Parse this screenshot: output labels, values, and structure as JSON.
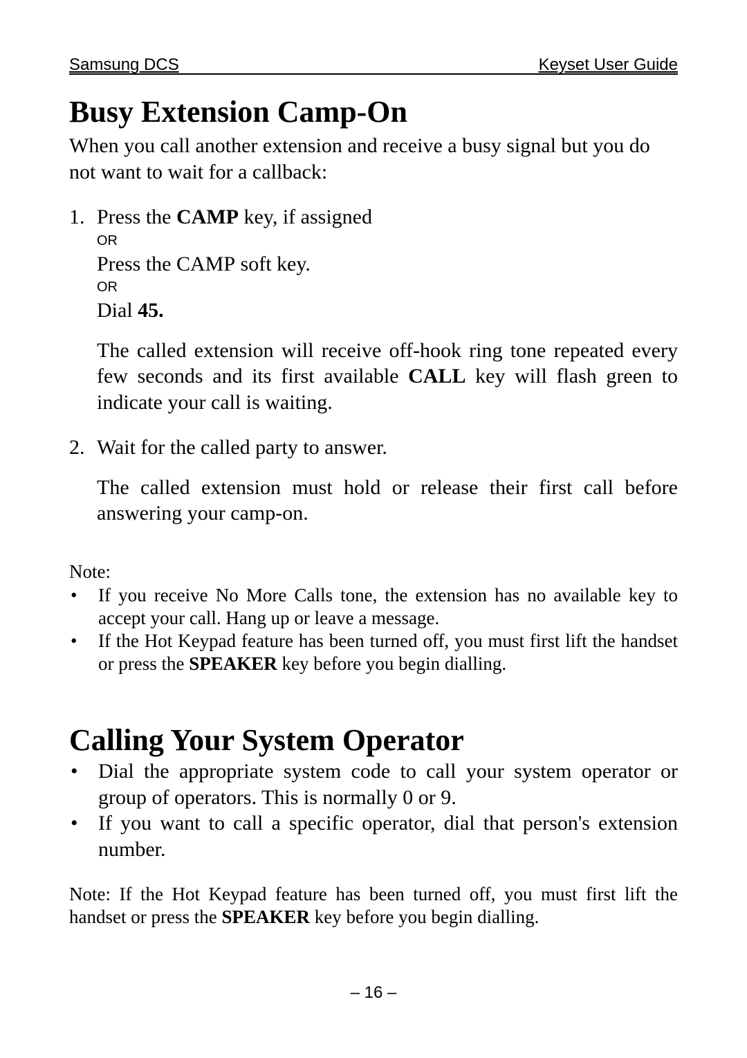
{
  "header": {
    "left": "Samsung DCS",
    "right": "Keyset User Guide"
  },
  "sec1": {
    "title": "Busy Extension Camp-On",
    "intro": "When you call another extension and receive a busy signal but you do not want to wait for a callback:",
    "step1_num": "1.",
    "step1_l1_pre": "Press the ",
    "step1_l1_key": "CAMP",
    "step1_l1_post": " key, if assigned",
    "or": "OR",
    "step1_l2_pre": "Press the ",
    "step1_l2_key": "CAMP",
    "step1_l2_post": " soft key.",
    "step1_l3_pre": "Dial ",
    "step1_l3_bold": "45.",
    "step1_detail_a": "The called extension will receive off-hook ring tone repeated every few seconds and its first available ",
    "step1_detail_key": "CALL",
    "step1_detail_b": " key will flash green to indicate your call is waiting.",
    "step2_num": "2.",
    "step2_l1": "Wait for the called party to answer.",
    "step2_detail": "The called extension must hold or release their first call before answering your camp-on.",
    "note_heading": "Note:",
    "note_b1": "If you receive No More Calls tone, the extension has no available key to accept your call. Hang up or leave a message.",
    "note_b2_a": "If the Hot Keypad feature has been turned off, you must first lift the handset or press the ",
    "note_b2_key": "SPEAKER",
    "note_b2_b": " key before you begin dialling."
  },
  "sec2": {
    "title": "Calling Your System Operator",
    "b1": "Dial the appropriate system code to call your system operator or group of operators. This is normally 0 or 9.",
    "b2": "If you want to call a specific operator, dial that person's extension number.",
    "note_a": "Note: If the Hot Keypad feature has been turned off, you must first lift the handset or press the ",
    "note_key": "SPEAKER",
    "note_b": " key before you begin dialling."
  },
  "page_number": "– 16 –"
}
